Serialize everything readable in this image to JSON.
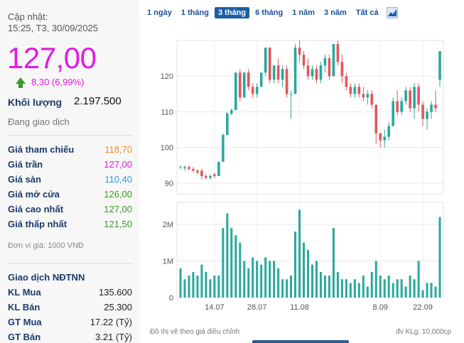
{
  "header": {
    "updated_label": "Cập nhật:",
    "updated_time": "15:25, T3, 30/09/2025"
  },
  "quote": {
    "price": "127,00",
    "change": "8,30 (6,99%)",
    "volume_label": "Khối lượng",
    "volume_value": "2.197.500",
    "status": "Đang giao dịch"
  },
  "price_rows": [
    {
      "label": "Giá tham chiếu",
      "value": "118,70",
      "color": "#f08c1a"
    },
    {
      "label": "Giá trần",
      "value": "127,00",
      "color": "#e11be1"
    },
    {
      "label": "Giá sàn",
      "value": "110,40",
      "color": "#2a9fd8"
    },
    {
      "label": "Giá mở cửa",
      "value": "126,00",
      "color": "#3a9a2a"
    },
    {
      "label": "Giá cao nhất",
      "value": "127,00",
      "color": "#3a9a2a"
    },
    {
      "label": "Giá thấp nhất",
      "value": "121,50",
      "color": "#3a9a2a"
    }
  ],
  "unit_note": "Đơn vị giá: 1000 VNĐ",
  "foreign": {
    "title": "Giao dịch NĐTNN",
    "rows": [
      {
        "label": "KL Mua",
        "value": "135.600"
      },
      {
        "label": "KL Bán",
        "value": "25.300"
      },
      {
        "label": "GT Mua",
        "value": "17.22 (Tỷ)"
      },
      {
        "label": "GT Bán",
        "value": "3.21 (Tỷ)"
      }
    ]
  },
  "tabs": [
    {
      "label": "1 ngày",
      "active": false
    },
    {
      "label": "1 tháng",
      "active": false
    },
    {
      "label": "3 tháng",
      "active": true
    },
    {
      "label": "6 tháng",
      "active": false
    },
    {
      "label": "1 năm",
      "active": false
    },
    {
      "label": "3 năm",
      "active": false
    },
    {
      "label": "Tất cả",
      "active": false
    }
  ],
  "chart_icon": "chart-icon",
  "chart_note": "Đồ thị vẽ theo giá điều chỉnh",
  "volume_unit": "đv KLg: 10,000cp",
  "colors": {
    "up": "#e15759",
    "down": "#2aa89a"
  },
  "chart_data": {
    "type": "candlestick",
    "price_ticks": [
      90,
      100,
      110,
      120
    ],
    "ylim": [
      87,
      130
    ],
    "volume_ticks": [
      "0",
      "1M",
      "2M"
    ],
    "volume_ylim": [
      0,
      2.6
    ],
    "x_ticks": [
      {
        "label": "14.07",
        "index": 8
      },
      {
        "label": "28.07",
        "index": 18
      },
      {
        "label": "11.08",
        "index": 28
      },
      {
        "label": "8.09",
        "index": 47
      },
      {
        "label": "22.09",
        "index": 57
      }
    ],
    "candles": [
      [
        94.5,
        95,
        94,
        94.5,
        0.8
      ],
      [
        94.2,
        95,
        93.5,
        94.5,
        0.5
      ],
      [
        94.5,
        95,
        93.5,
        94,
        0.6
      ],
      [
        94,
        94.5,
        93,
        93.5,
        0.7
      ],
      [
        93.5,
        94,
        92.5,
        93,
        0.6
      ],
      [
        93.5,
        94,
        91,
        92,
        0.9
      ],
      [
        92,
        92.5,
        91,
        91.5,
        0.7
      ],
      [
        91.5,
        92.5,
        91,
        92,
        0.5
      ],
      [
        92.5,
        93,
        91.5,
        92,
        0.6
      ],
      [
        92,
        96,
        92,
        96,
        0.6
      ],
      [
        96,
        104,
        96,
        103.5,
        1.9
      ],
      [
        103.5,
        110,
        103.5,
        109.5,
        2.3
      ],
      [
        109.5,
        111,
        109,
        110.5,
        1.9
      ],
      [
        110.5,
        121,
        110.5,
        121,
        1.7
      ],
      [
        121,
        122,
        113,
        114,
        1.5
      ],
      [
        114,
        121,
        114,
        121,
        1.0
      ],
      [
        121,
        122,
        116,
        117,
        0.8
      ],
      [
        117,
        118,
        114,
        115,
        1.1
      ],
      [
        115,
        118,
        114,
        117,
        1.0
      ],
      [
        117,
        121,
        117,
        121,
        0.9
      ],
      [
        121,
        128,
        120,
        128,
        1.1
      ],
      [
        128,
        128,
        118,
        119,
        1.0
      ],
      [
        119,
        123,
        118,
        123,
        1.0
      ],
      [
        123,
        125,
        118,
        119,
        0.8
      ],
      [
        119,
        123,
        117,
        122,
        0.5
      ],
      [
        122,
        123,
        114,
        115,
        0.5
      ],
      [
        115,
        116,
        108,
        115,
        0.6
      ],
      [
        115,
        129,
        115,
        128,
        1.8
      ],
      [
        128,
        130,
        124,
        126,
        2.4
      ],
      [
        126,
        127,
        122,
        123,
        1.5
      ],
      [
        123,
        125,
        119,
        120,
        1.3
      ],
      [
        120,
        123,
        119,
        122,
        0.9
      ],
      [
        122,
        123,
        118,
        119,
        1.0
      ],
      [
        119,
        124,
        118,
        123,
        0.7
      ],
      [
        123,
        126,
        121,
        125,
        0.6
      ],
      [
        125,
        126,
        119,
        120,
        0.6
      ],
      [
        120,
        129,
        120,
        129,
        1.9
      ],
      [
        129,
        130,
        123,
        124,
        0.7
      ],
      [
        124,
        126,
        118,
        120,
        0.5
      ],
      [
        120,
        121,
        116,
        117,
        0.5
      ],
      [
        117,
        118,
        114,
        115,
        0.4
      ],
      [
        115,
        118,
        114,
        117,
        0.5
      ],
      [
        117,
        118,
        114,
        115,
        0.4
      ],
      [
        115,
        117,
        113,
        114,
        0.6
      ],
      [
        114,
        116,
        112,
        115,
        0.3
      ],
      [
        115,
        116,
        111,
        112,
        0.7
      ],
      [
        112,
        112,
        101,
        104,
        1.0
      ],
      [
        104,
        104,
        100,
        102,
        0.6
      ],
      [
        102,
        105,
        100,
        103,
        0.5
      ],
      [
        103,
        107,
        102,
        106,
        0.6
      ],
      [
        106,
        114,
        106,
        113,
        0.4
      ],
      [
        113,
        116,
        109,
        110,
        0.5
      ],
      [
        110,
        114,
        109,
        113,
        0.5
      ],
      [
        113,
        117,
        112,
        116,
        0.3
      ],
      [
        116,
        117,
        110,
        111,
        0.6
      ],
      [
        111,
        118,
        108,
        117,
        0.5
      ],
      [
        117,
        118,
        110,
        112,
        1.0
      ],
      [
        112,
        113,
        106,
        108,
        0.2
      ],
      [
        108,
        111,
        105,
        110,
        0.4
      ],
      [
        110,
        113,
        108,
        112,
        0.4
      ],
      [
        112,
        116,
        110,
        111,
        0.3
      ],
      [
        119,
        127,
        117,
        127,
        2.2
      ]
    ]
  }
}
